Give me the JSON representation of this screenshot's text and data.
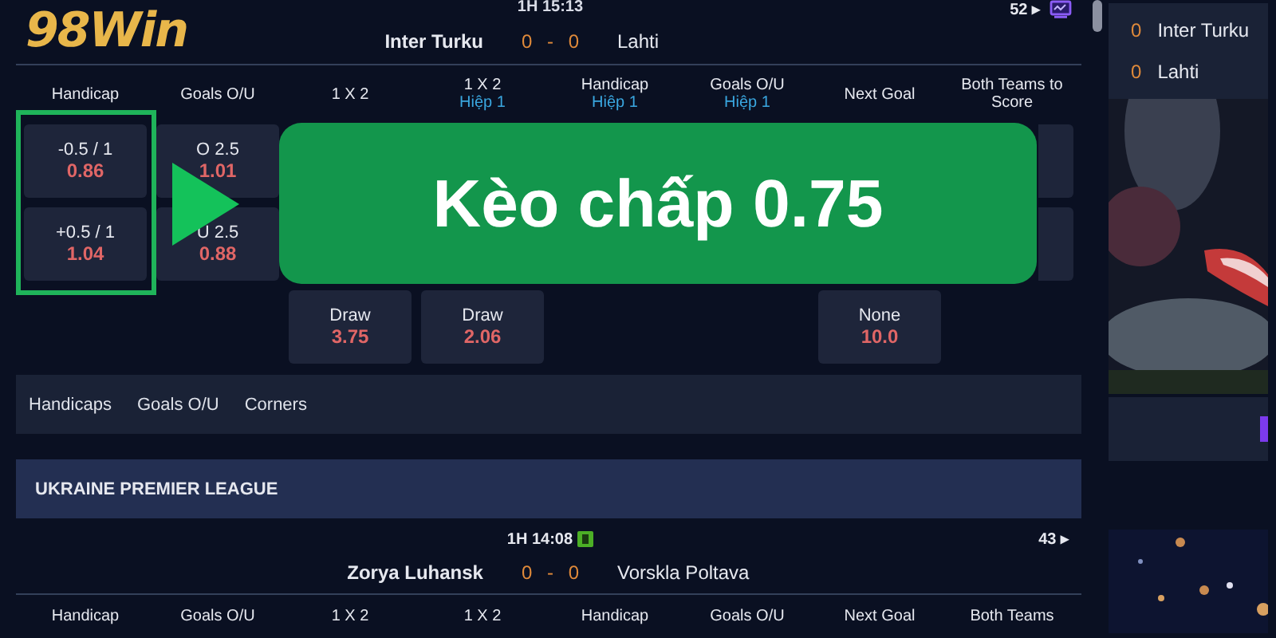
{
  "logo": "98Win",
  "match": {
    "period": "1H",
    "clock": "15:13",
    "home": "Inter Turku",
    "home_score": "0",
    "score_separator": "-",
    "away_score": "0",
    "away": "Lahti",
    "markets_count": "52",
    "arrow": "▸"
  },
  "columns": [
    {
      "label": "Handicap"
    },
    {
      "label": "Goals O/U"
    },
    {
      "label": "1 X 2"
    },
    {
      "label": "1 X 2",
      "sub": "Hiệp 1"
    },
    {
      "label": "Handicap",
      "sub": "Hiệp 1"
    },
    {
      "label": "Goals O/U",
      "sub": "Hiệp 1"
    },
    {
      "label": "Next Goal"
    },
    {
      "label": "Both Teams to Score"
    }
  ],
  "odds_rows": [
    [
      {
        "kind": "bet",
        "line": "-0.5 / 1",
        "odds": "0.86"
      },
      {
        "kind": "bet",
        "line": "O 2.5",
        "odds": "1.01"
      },
      {
        "kind": "covered"
      },
      {
        "kind": "covered"
      },
      {
        "kind": "covered"
      },
      {
        "kind": "covered"
      },
      {
        "kind": "covered"
      },
      {
        "kind": "edge"
      }
    ],
    [
      {
        "kind": "bet",
        "line": "+0.5 / 1",
        "odds": "1.04"
      },
      {
        "kind": "bet",
        "line": "U 2.5",
        "odds": "0.88"
      },
      {
        "kind": "covered"
      },
      {
        "kind": "covered"
      },
      {
        "kind": "covered"
      },
      {
        "kind": "covered"
      },
      {
        "kind": "covered"
      },
      {
        "kind": "edge"
      }
    ],
    [
      {
        "kind": "empty"
      },
      {
        "kind": "empty"
      },
      {
        "kind": "bet",
        "line": "Draw",
        "odds": "3.75"
      },
      {
        "kind": "bet",
        "line": "Draw",
        "odds": "2.06"
      },
      {
        "kind": "empty"
      },
      {
        "kind": "empty"
      },
      {
        "kind": "bet",
        "line": "None",
        "odds": "10.0"
      },
      {
        "kind": "empty"
      }
    ]
  ],
  "banner": {
    "label": "Kèo chấp 0.75"
  },
  "market_tabs": [
    {
      "label": "Handicaps"
    },
    {
      "label": "Goals O/U"
    },
    {
      "label": "Corners"
    }
  ],
  "league": {
    "name": "UKRAINE PREMIER LEAGUE"
  },
  "match2": {
    "period": "1H",
    "clock": "14:08",
    "home": "Zorya Luhansk",
    "home_score": "0",
    "score_separator": "-",
    "away_score": "0",
    "away": "Vorskla Poltava",
    "markets_count": "43",
    "arrow": "▸"
  },
  "columns2": [
    {
      "label": "Handicap"
    },
    {
      "label": "Goals O/U"
    },
    {
      "label": "1 X 2"
    },
    {
      "label": "1 X 2"
    },
    {
      "label": "Handicap"
    },
    {
      "label": "Goals O/U"
    },
    {
      "label": "Next Goal"
    },
    {
      "label": "Both Teams"
    }
  ],
  "scoreboard": [
    {
      "score": "0",
      "team": "Inter Turku"
    },
    {
      "score": "0",
      "team": "Lahti"
    }
  ]
}
